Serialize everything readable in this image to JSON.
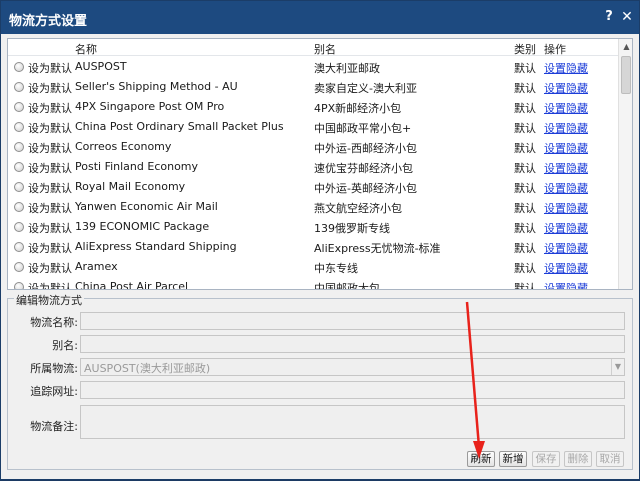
{
  "window": {
    "title": "物流方式设置",
    "help": "?",
    "close": "✕"
  },
  "grid": {
    "headers": {
      "name": "名称",
      "alias": "别名",
      "type": "类别",
      "action": "操作"
    },
    "rows": [
      {
        "setdef": "设为默认",
        "name": "AUSPOST",
        "alias": "澳大利亚邮政",
        "type": "默认",
        "action": "设置隐藏"
      },
      {
        "setdef": "设为默认",
        "name": "Seller's Shipping Method - AU",
        "alias": "卖家自定义-澳大利亚",
        "type": "默认",
        "action": "设置隐藏"
      },
      {
        "setdef": "设为默认",
        "name": "4PX Singapore Post OM Pro",
        "alias": "4PX新邮经济小包",
        "type": "默认",
        "action": "设置隐藏"
      },
      {
        "setdef": "设为默认",
        "name": "China Post Ordinary Small Packet Plus",
        "alias": "中国邮政平常小包+",
        "type": "默认",
        "action": "设置隐藏"
      },
      {
        "setdef": "设为默认",
        "name": "Correos Economy",
        "alias": "中外运-西邮经济小包",
        "type": "默认",
        "action": "设置隐藏"
      },
      {
        "setdef": "设为默认",
        "name": "Posti Finland Economy",
        "alias": "速优宝芬邮经济小包",
        "type": "默认",
        "action": "设置隐藏"
      },
      {
        "setdef": "设为默认",
        "name": "Royal Mail Economy",
        "alias": "中外运-英邮经济小包",
        "type": "默认",
        "action": "设置隐藏"
      },
      {
        "setdef": "设为默认",
        "name": "Yanwen Economic Air Mail",
        "alias": "燕文航空经济小包",
        "type": "默认",
        "action": "设置隐藏"
      },
      {
        "setdef": "设为默认",
        "name": "139 ECONOMIC Package",
        "alias": "139俄罗斯专线",
        "type": "默认",
        "action": "设置隐藏"
      },
      {
        "setdef": "设为默认",
        "name": "AliExpress Standard Shipping",
        "alias": "AliExpress无忧物流-标准",
        "type": "默认",
        "action": "设置隐藏"
      },
      {
        "setdef": "设为默认",
        "name": "Aramex",
        "alias": "中东专线",
        "type": "默认",
        "action": "设置隐藏"
      },
      {
        "setdef": "设为默认",
        "name": "China Post Air Parcel",
        "alias": "中国邮政大包",
        "type": "默认",
        "action": "设置隐藏"
      }
    ]
  },
  "edit": {
    "legend": "编辑物流方式",
    "labels": {
      "name": "物流名称:",
      "alias": "别名:",
      "carrier": "所属物流:",
      "tracking": "追踪网址:",
      "note": "物流备注:"
    },
    "carrier_value": "AUSPOST(澳大利亚邮政)",
    "name_value": "",
    "alias_value": "",
    "tracking_value": "",
    "note_value": ""
  },
  "buttons": {
    "refresh": "刷新",
    "add": "新增",
    "save": "保存",
    "delete": "删除",
    "cancel": "取消"
  },
  "colors": {
    "titlebar": "#1d4a80",
    "link": "#1b3cd8",
    "annotation": "#e8221b"
  }
}
